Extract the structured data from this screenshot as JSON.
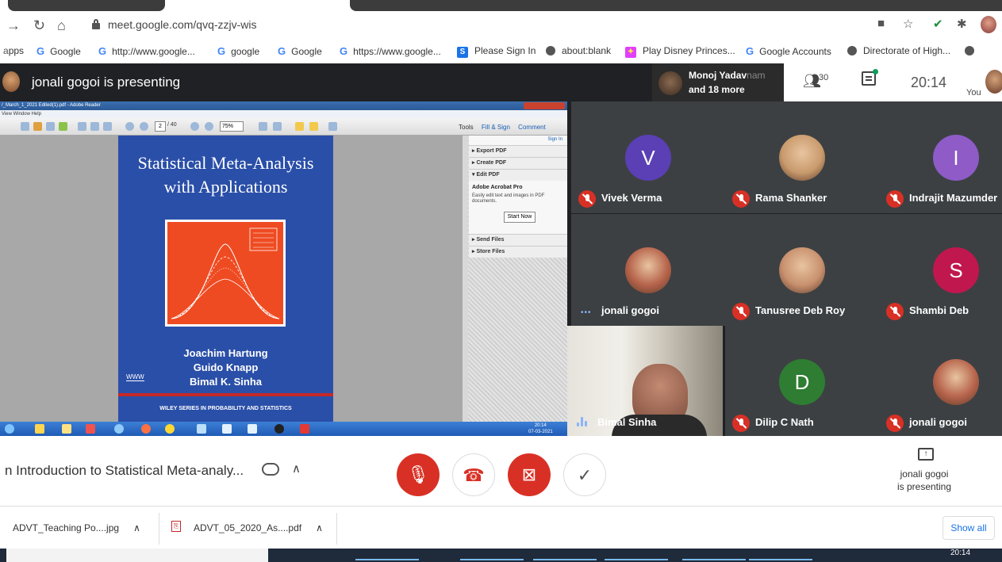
{
  "browser": {
    "url": "meet.google.com/qvq-zzjv-wis",
    "bookmarks": [
      {
        "icon": "apps",
        "label": "pps"
      },
      {
        "icon": "google-icon",
        "label": "Google"
      },
      {
        "icon": "google-icon",
        "label": "http://www.google..."
      },
      {
        "icon": "google-icon",
        "label": "google"
      },
      {
        "icon": "google-icon",
        "label": "Google"
      },
      {
        "icon": "google-icon",
        "label": "https://www.google..."
      },
      {
        "icon": "sign-in-icon",
        "label": "Please Sign In"
      },
      {
        "icon": "globe-icon",
        "label": "about:blank"
      },
      {
        "icon": "disney-icon",
        "label": "Play Disney Princes..."
      },
      {
        "icon": "google-icon",
        "label": "Google Accounts"
      },
      {
        "icon": "globe-icon",
        "label": "Directorate of High..."
      }
    ]
  },
  "meet": {
    "presenting_banner": "jonali gogoi is presenting",
    "active_speaker": {
      "name": "Monoj Yadav",
      "name_faded": "nam",
      "more": "and 18 more"
    },
    "participant_count": "30",
    "time": "20:14",
    "you_label": "You",
    "participants": [
      {
        "name": "Vivek Verma",
        "initial": "V",
        "color": "#5b3fb4",
        "mic": "off",
        "photo": false
      },
      {
        "name": "Rama Shanker",
        "initial": "",
        "color": "#c99b6d",
        "mic": "off",
        "photo": true
      },
      {
        "name": "Indrajit Mazumder",
        "initial": "I",
        "color": "#8e5bc7",
        "mic": "off",
        "photo": false
      },
      {
        "name": "jonali gogoi",
        "initial": "",
        "color": "#b6634b",
        "mic": "speaking",
        "photo": true
      },
      {
        "name": "Tanusree Deb Roy",
        "initial": "",
        "color": "#c8906e",
        "mic": "off",
        "photo": true
      },
      {
        "name": "Shambi Deb",
        "initial": "S",
        "color": "#c0174f",
        "mic": "off",
        "photo": false
      },
      {
        "name": "Bimal Sinha",
        "initial": "",
        "color": "#6a6a6a",
        "mic": "wave",
        "photo": "video"
      },
      {
        "name": "Dilip C Nath",
        "initial": "D",
        "color": "#2e7d32",
        "mic": "off",
        "photo": false
      },
      {
        "name": "jonali gogoi",
        "initial": "",
        "color": "#b6634b",
        "mic": "off",
        "photo": true
      }
    ],
    "meeting_title": "n Introduction to Statistical Meta-analy...",
    "present_status_line1": "jonali gogoi",
    "present_status_line2": "is presenting"
  },
  "shared_screen": {
    "window_title": "/_March_1_2021 Edited(1).pdf - Adobe Reader",
    "menu": "View  Window  Help",
    "page_current": "2",
    "page_total": "/ 40",
    "zoom": "75%",
    "tabs": [
      "Tools",
      "Fill & Sign",
      "Comment"
    ],
    "side_sign_in": "Sign In",
    "side_sections_top": [
      "Export PDF",
      "Create PDF",
      "Edit PDF"
    ],
    "acrobat_pro": "Adobe Acrobat Pro",
    "acrobat_desc": "Easily edit text and images in PDF documents.",
    "start_now": "Start Now",
    "side_sections_bottom": [
      "Send Files",
      "Store Files"
    ],
    "book": {
      "title_line1": "Statistical Meta-Analysis",
      "title_line2": "with Applications",
      "authors": [
        "Joachim Hartung",
        "Guido Knapp",
        "Bimal K. Sinha"
      ],
      "publisher_mark": "WWW",
      "series": "WILEY SERIES IN PROBABILITY AND STATISTICS"
    },
    "taskbar_time": "20:14",
    "taskbar_date": "07-03-2021"
  },
  "downloads": {
    "items": [
      "ADVT_Teaching Po....jpg",
      "ADVT_05_2020_As....pdf"
    ],
    "show_all": "Show all"
  },
  "windows": {
    "time": "20:14"
  }
}
